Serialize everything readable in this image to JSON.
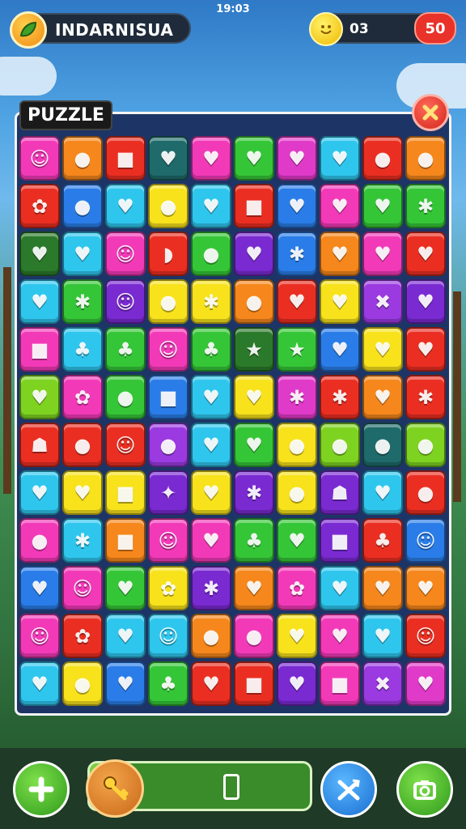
{
  "status": {
    "time": "19:03"
  },
  "player": {
    "name": "INDARNISUA"
  },
  "coins": {
    "value": "03"
  },
  "energy": {
    "value": "50"
  },
  "board": {
    "title": "PUZZLE"
  },
  "colors": {
    "pink": "#f23ab8",
    "orange": "#f6871c",
    "red": "#ea2f22",
    "teal": "#1f6a6a",
    "green": "#35c637",
    "blue": "#2a7de8",
    "yellow": "#f7e21c",
    "cyan": "#2fc6ee",
    "purple": "#7a2ad1",
    "magenta": "#e03ac8",
    "lime": "#7ed321",
    "darkred": "#a4141e",
    "darkgreen": "#2b7a2b",
    "violet": "#9a3ae0"
  },
  "tiles": [
    [
      "pink",
      "orange",
      "red",
      "teal",
      "pink",
      "green",
      "magenta",
      "cyan",
      "red",
      "orange"
    ],
    [
      "red",
      "blue",
      "cyan",
      "yellow",
      "cyan",
      "red",
      "blue",
      "pink",
      "green",
      "green"
    ],
    [
      "darkgreen",
      "cyan",
      "pink",
      "red",
      "green",
      "purple",
      "blue",
      "orange",
      "pink",
      "red"
    ],
    [
      "cyan",
      "green",
      "purple",
      "yellow",
      "yellow",
      "orange",
      "red",
      "yellow",
      "violet",
      "purple"
    ],
    [
      "pink",
      "cyan",
      "green",
      "pink",
      "green",
      "darkgreen",
      "green",
      "blue",
      "yellow",
      "red"
    ],
    [
      "lime",
      "pink",
      "green",
      "blue",
      "cyan",
      "yellow",
      "magenta",
      "red",
      "orange",
      "red"
    ],
    [
      "red",
      "red",
      "red",
      "violet",
      "cyan",
      "green",
      "yellow",
      "lime",
      "teal",
      "lime"
    ],
    [
      "cyan",
      "yellow",
      "yellow",
      "purple",
      "yellow",
      "purple",
      "yellow",
      "purple",
      "cyan",
      "red"
    ],
    [
      "pink",
      "cyan",
      "orange",
      "pink",
      "pink",
      "green",
      "green",
      "purple",
      "red",
      "blue"
    ],
    [
      "blue",
      "pink",
      "green",
      "yellow",
      "purple",
      "orange",
      "pink",
      "cyan",
      "orange",
      "orange"
    ],
    [
      "pink",
      "red",
      "cyan",
      "cyan",
      "orange",
      "pink",
      "yellow",
      "pink",
      "cyan",
      "red"
    ],
    [
      "cyan",
      "yellow",
      "blue",
      "green",
      "red",
      "red",
      "purple",
      "pink",
      "violet",
      "magenta"
    ]
  ],
  "glyphs": [
    [
      "☺",
      "●",
      "■",
      "♥",
      "♥",
      "♥",
      "♥",
      "♥",
      "●",
      "●"
    ],
    [
      "✿",
      "●",
      "♥",
      "●",
      "♥",
      "■",
      "♥",
      "♥",
      "♥",
      "✱"
    ],
    [
      "♥",
      "♥",
      "☺",
      "◗",
      "●",
      "♥",
      "✱",
      "♥",
      "♥",
      "♥"
    ],
    [
      "♥",
      "✱",
      "☺",
      "●",
      "✱",
      "●",
      "♥",
      "♥",
      "✖",
      "♥"
    ],
    [
      "■",
      "♣",
      "♣",
      "☺",
      "♣",
      "★",
      "★",
      "♥",
      "♥",
      "♥"
    ],
    [
      "♥",
      "✿",
      "●",
      "■",
      "♥",
      "♥",
      "✱",
      "✱",
      "♥",
      "✱"
    ],
    [
      "☗",
      "●",
      "☺",
      "●",
      "♥",
      "♥",
      "●",
      "●",
      "●",
      "●"
    ],
    [
      "♥",
      "♥",
      "■",
      "✦",
      "♥",
      "✱",
      "●",
      "☗",
      "♥",
      "●"
    ],
    [
      "●",
      "✱",
      "■",
      "☺",
      "♥",
      "♣",
      "♥",
      "■",
      "♣",
      "☺"
    ],
    [
      "♥",
      "☺",
      "♥",
      "✿",
      "✱",
      "♥",
      "✿",
      "♥",
      "♥",
      "♥"
    ],
    [
      "☺",
      "✿",
      "♥",
      "☺",
      "●",
      "●",
      "♥",
      "♥",
      "♥",
      "☺"
    ],
    [
      "♥",
      "●",
      "♥",
      "♣",
      "♥",
      "■",
      "♥",
      "■",
      "✖",
      "♥"
    ]
  ],
  "bottom": {
    "add_icon": "plus-icon",
    "key_icon": "key-icon",
    "progress": 0.2,
    "shuffle_icon": "shuffle-icon",
    "camera_icon": "camera-icon"
  }
}
